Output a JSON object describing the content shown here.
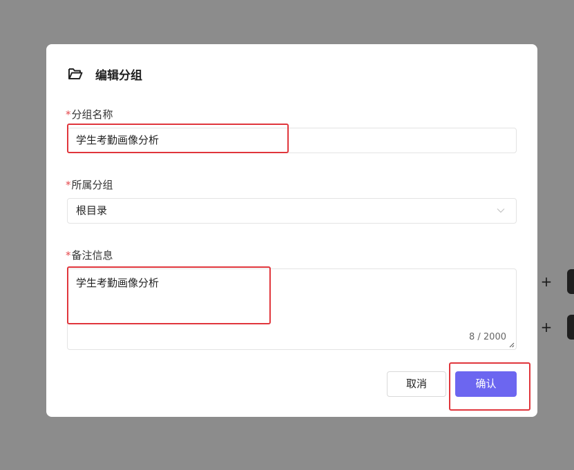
{
  "dialog": {
    "title": "编辑分组",
    "icon": "folder-open-icon",
    "fields": {
      "group_name": {
        "required_mark": "*",
        "label": "分组名称",
        "value": "学生考勤画像分析"
      },
      "parent_group": {
        "required_mark": "*",
        "label": "所属分组",
        "selected": "根目录"
      },
      "remark": {
        "required_mark": "*",
        "label": "备注信息",
        "value": "学生考勤画像分析",
        "counter": "8 / 2000"
      }
    },
    "buttons": {
      "cancel": "取消",
      "confirm": "确认"
    }
  },
  "background": {
    "plus_symbol": "+"
  },
  "colors": {
    "overlay": "#8c8c8c",
    "primary": "#6c66f0",
    "highlight": "#e0353b",
    "required": "#e5484d"
  }
}
